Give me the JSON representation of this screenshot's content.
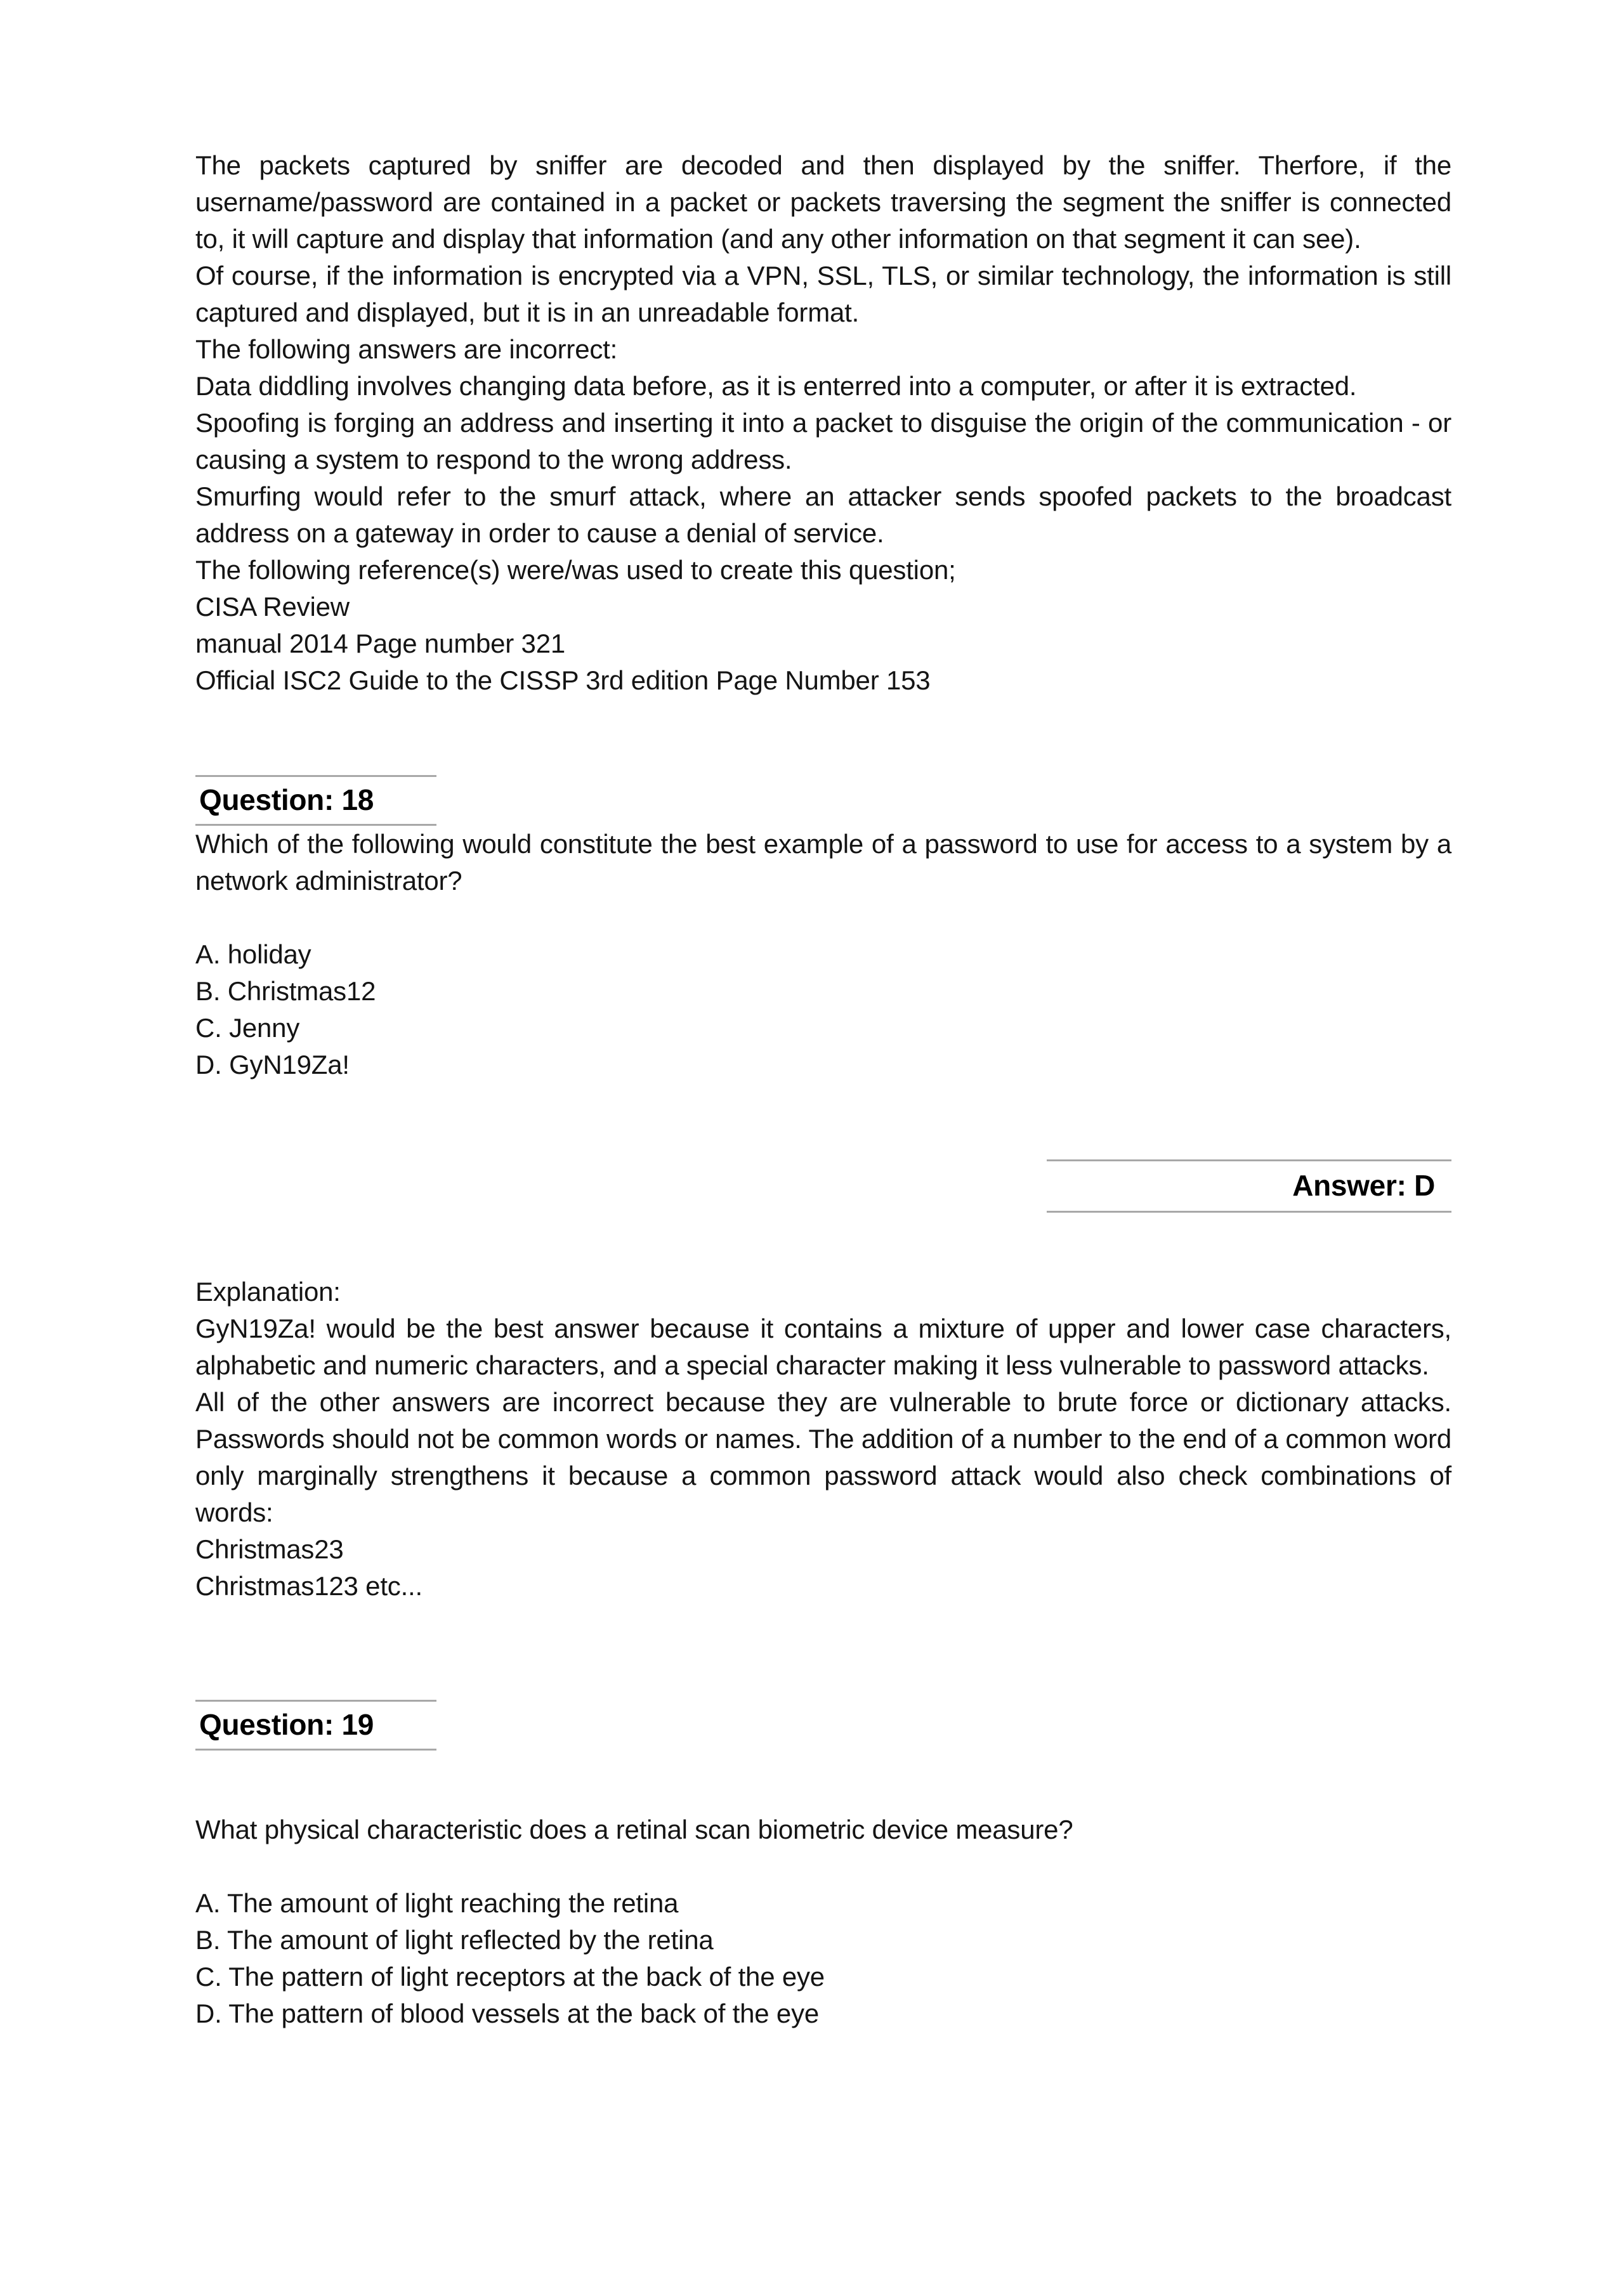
{
  "document": {
    "background_color": "#ffffff",
    "text_color": "#141414",
    "rule_color": "#a8a8a8"
  },
  "intro": {
    "paragraph_1": "The packets captured by sniffer are decoded and then displayed by the sniffer. Therfore, if the username/password are contained in a packet or packets traversing the segment the sniffer is connected to, it will capture and display that information (and any other information on that segment it can see).",
    "paragraph_2": "Of course, if the information is encrypted via a VPN, SSL, TLS, or similar technology, the information is still captured and displayed, but it is in an unreadable format.",
    "paragraph_3": "The following answers are incorrect:",
    "paragraph_4": "Data diddling  involves changing data before, as it is enterred into a computer, or after it is extracted.",
    "paragraph_5": "Spoofing is forging an address and inserting it into a packet to disguise the origin of the communication - or causing a system to respond to the wrong address.",
    "paragraph_6": "Smurfing would refer to the smurf attack, where an attacker sends spoofed packets to the broadcast address on a gateway in order to cause a denial of service.",
    "paragraph_7": "The following reference(s) were/was used to create this question;",
    "reference_1": "CISA Review",
    "reference_2": "manual 2014 Page number 321",
    "reference_3": "Official ISC2 Guide to the CISSP 3rd edition Page Number 153"
  },
  "question_18": {
    "header": "Question: 18",
    "stem": "Which of the following would constitute the best example of a password to use for access to a system by a network administrator?",
    "options": [
      "A. holiday",
      "B. Christmas12",
      "C. Jenny",
      "D. GyN19Za!"
    ],
    "answer": "Answer: D",
    "explanation_label": "Explanation:",
    "explanation_1": "GyN19Za! would be the best answer because it contains a mixture of upper and lower case characters, alphabetic and numeric characters, and a special character making it less vulnerable to password attacks.",
    "explanation_2": "All of the other answers are incorrect because they are vulnerable to brute force or dictionary attacks. Passwords should not be common words or names. The addition of a number to the end of a common word only marginally strengthens it because a common password attack would also check combinations of words:",
    "example_1": "Christmas23",
    "example_2": "Christmas123 etc..."
  },
  "question_19": {
    "header": "Question: 19",
    "stem": "What physical characteristic does a retinal scan biometric device measure?",
    "options": [
      "A. The amount of light reaching the retina",
      "B. The amount of light reflected by the retina",
      "C. The pattern of light receptors at the back of the eye",
      "D. The pattern of blood vessels at the back of the eye"
    ]
  }
}
